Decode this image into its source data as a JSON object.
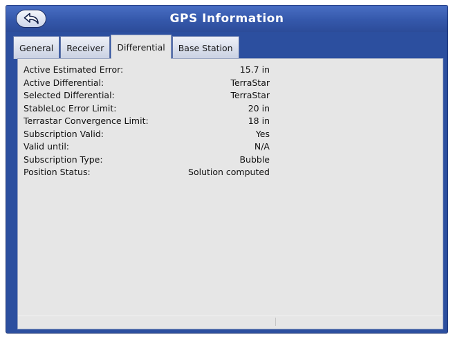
{
  "window": {
    "title": "GPS Information",
    "back_icon": "back-arrow-icon"
  },
  "tabs": [
    {
      "label": "General",
      "active": false
    },
    {
      "label": "Receiver",
      "active": false
    },
    {
      "label": "Differential",
      "active": true
    },
    {
      "label": "Base Station",
      "active": false
    }
  ],
  "differential": {
    "rows": [
      {
        "label": "Active Estimated Error:",
        "value": "15.7 in"
      },
      {
        "label": "Active Differential:",
        "value": "TerraStar"
      },
      {
        "label": "Selected Differential:",
        "value": "TerraStar"
      },
      {
        "label": "StableLoc Error Limit:",
        "value": "20 in"
      },
      {
        "label": "Terrastar Convergence Limit:",
        "value": "18 in"
      },
      {
        "label": "Subscription Valid:",
        "value": "Yes"
      },
      {
        "label": "Valid until:",
        "value": "N/A"
      },
      {
        "label": "Subscription Type:",
        "value": "Bubble"
      },
      {
        "label": "Position Status:",
        "value": "Solution computed"
      }
    ]
  },
  "colors": {
    "titlebar": "#3558ab",
    "window_frame": "#2c4f9f",
    "panel_background": "#e6e6e6",
    "title_text": "#ffffff"
  }
}
